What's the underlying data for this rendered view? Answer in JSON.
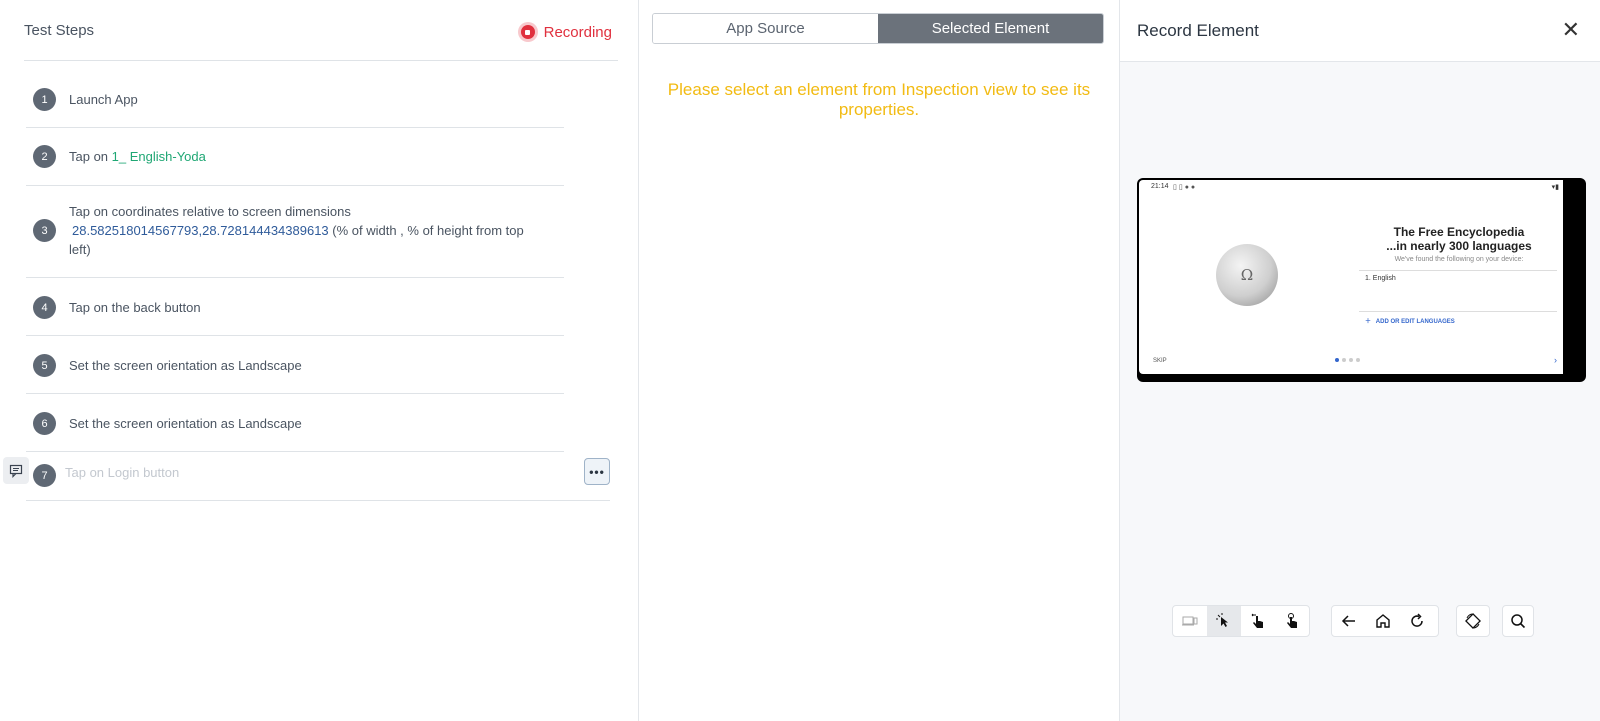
{
  "left": {
    "title": "Test Steps",
    "recording_label": "Recording",
    "steps": [
      {
        "num": "1",
        "text": "Launch App"
      },
      {
        "num": "2",
        "prefix": "Tap on ",
        "highlight": "1_ English-Yoda"
      },
      {
        "num": "3",
        "line1": "Tap on coordinates relative to screen dimensions",
        "coords": "28.582518014567793,28.728144434389613",
        "suffix": " (% of width , % of height from top left)"
      },
      {
        "num": "4",
        "text": "Tap on the back button"
      },
      {
        "num": "5",
        "text": "Set the screen orientation as Landscape"
      },
      {
        "num": "6",
        "text": "Set the screen orientation as Landscape"
      },
      {
        "num": "7",
        "placeholder": "Tap on Login button",
        "more_label": "•••"
      }
    ]
  },
  "middle": {
    "tabs": [
      {
        "label": "App Source",
        "active": false
      },
      {
        "label": "Selected Element",
        "active": true
      }
    ],
    "notice": "Please select an element from Inspection view to see its properties."
  },
  "right": {
    "title": "Record Element",
    "close_label": "✕",
    "device": {
      "time": "21:14",
      "title_line1": "The Free Encyclopedia",
      "title_line2": "...in nearly 300 languages",
      "subtitle": "We've found the following on your device:",
      "language": "1.   English",
      "add_languages": "ADD OR EDIT LANGUAGES",
      "skip": "SKIP"
    },
    "toolbar": {
      "group1": [
        "device-icon",
        "select-icon",
        "swipe-icon",
        "tap-icon"
      ],
      "group2": [
        "back-icon",
        "home-icon",
        "refresh-icon"
      ],
      "group3": [
        "rotate-icon"
      ],
      "group4": [
        "search-icon"
      ]
    }
  },
  "colors": {
    "recording": "#e0303e",
    "highlight_green": "#1fa774",
    "coords_blue": "#2f5b9a",
    "notice_yellow": "#f2bb13",
    "active_tab": "#6b727b"
  }
}
